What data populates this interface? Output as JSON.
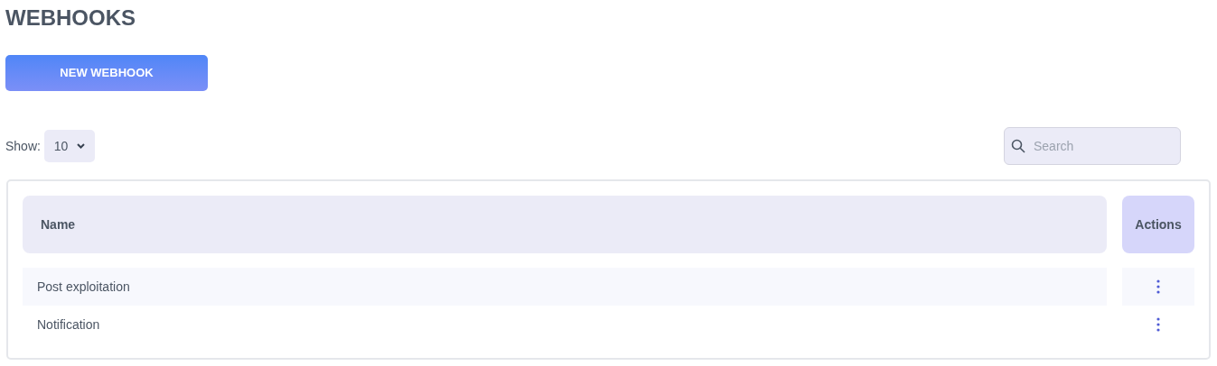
{
  "title": "WEBHOOKS",
  "new_button": "NEW WEBHOOK",
  "show": {
    "label": "Show:",
    "value": "10"
  },
  "search": {
    "placeholder": "Search"
  },
  "table": {
    "columns": [
      "Name",
      "Actions"
    ],
    "rows": [
      {
        "name": "Post exploitation"
      },
      {
        "name": "Notification"
      }
    ]
  }
}
